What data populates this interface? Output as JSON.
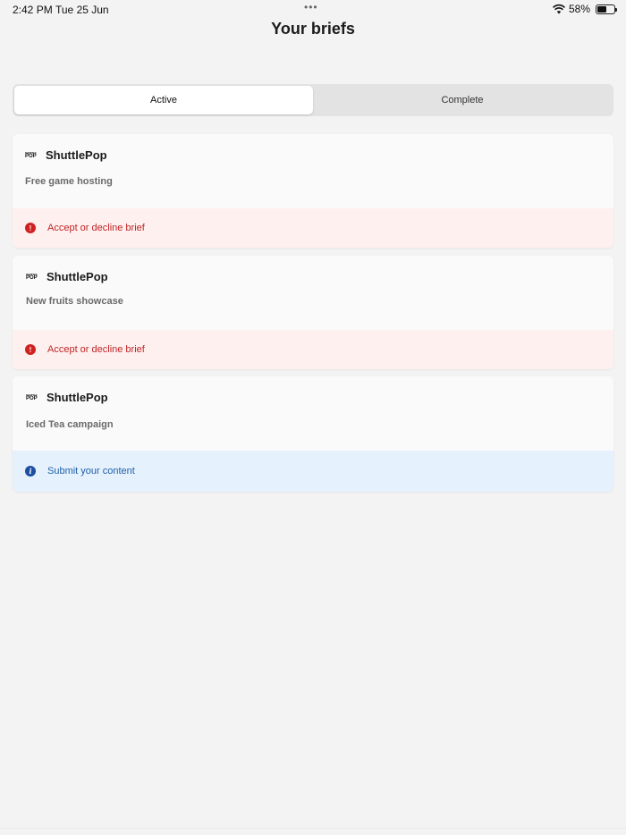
{
  "status_bar": {
    "time": "2:42 PM",
    "date": "Tue 25 Jun",
    "dots": "•••",
    "battery_percent": "58%",
    "battery_level": 0.58
  },
  "header": {
    "title": "Your briefs"
  },
  "tabs": [
    {
      "label": "Active",
      "selected": true
    },
    {
      "label": "Complete",
      "selected": false
    }
  ],
  "briefs": [
    {
      "brand": "ShuttlePop",
      "logo_small": "SHUTTLE",
      "logo_big": "POP",
      "title": "Free game hosting",
      "status": "Accept or decline brief",
      "status_type": "warning",
      "status_icon": "exclamation-icon"
    },
    {
      "brand": "ShuttlePop",
      "logo_small": "SHUTTLE",
      "logo_big": "POP",
      "title": "New fruits showcase",
      "status": "Accept or decline brief",
      "status_type": "warning",
      "status_icon": "exclamation-icon"
    },
    {
      "brand": "ShuttlePop",
      "logo_small": "SHUTTLE",
      "logo_big": "POP",
      "title": "Iced Tea campaign",
      "status": "Submit your content",
      "status_type": "info",
      "status_icon": "info-icon"
    }
  ],
  "colors": {
    "background": "#f3f3f3",
    "warning_bg": "#fff0f0",
    "warning_text": "#c02424",
    "info_bg": "#e5f1fd",
    "info_text": "#1f5fa8"
  }
}
